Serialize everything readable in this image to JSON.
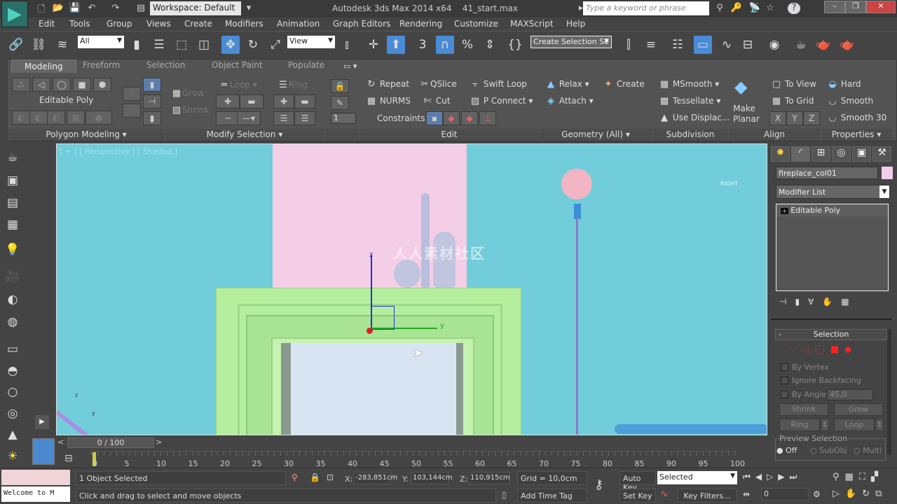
{
  "app": {
    "logo": "3ds Max logo",
    "title": "Autodesk 3ds Max  2014 x64",
    "file": "41_start.max",
    "workspace": "Workspace: Default",
    "search_placeholder": "Type a keyword or phrase"
  },
  "menu": [
    "Edit",
    "Tools",
    "Group",
    "Views",
    "Create",
    "Modifiers",
    "Animation",
    "Graph Editors",
    "Rendering",
    "Customize",
    "MAXScript",
    "Help"
  ],
  "toolbar": {
    "selection_filter": "All",
    "ref_coord": "View",
    "snap_label": "3",
    "named_selection": "Create Selection Se"
  },
  "ribbon": {
    "tabs": [
      "Modeling",
      "Freeform",
      "Selection",
      "Object Paint",
      "Populate"
    ],
    "active_tab": "Modeling",
    "polygon_modeling": {
      "object_type": "Editable Poly",
      "footer": "Polygon Modeling"
    },
    "modify_selection": {
      "grow": "Grow",
      "shrink": "Shrink",
      "loop": "Loop",
      "ring": "Ring",
      "footer": "Modify Selection"
    },
    "spinner_value": "1",
    "edit": {
      "repeat": "Repeat",
      "qslice": "QSlice",
      "swift_loop": "Swift Loop",
      "nurms": "NURMS",
      "cut": "Cut",
      "p_connect": "P Connect",
      "constraints": "Constraints:",
      "footer": "Edit"
    },
    "geometry": {
      "relax": "Relax",
      "create": "Create",
      "attach": "Attach",
      "footer": "Geometry (All)"
    },
    "subdivision": {
      "msmooth": "MSmooth",
      "tessellate": "Tessellate",
      "use_displace": "Use Displac...",
      "footer": "Subdivision"
    },
    "align": {
      "make_planar": "Make Planar",
      "to_view": "To View",
      "to_grid": "To Grid",
      "x": "X",
      "y": "Y",
      "z": "Z",
      "footer": "Align"
    },
    "properties": {
      "hard": "Hard",
      "smooth": "Smooth",
      "smooth30": "Smooth 30",
      "footer": "Properties"
    }
  },
  "viewport": {
    "label": "[ + ] [ Perspective ] [ Shaded ]",
    "viewcube": "RIGHT",
    "gizmo_z": "z",
    "gizmo_y": "y",
    "corner_z": "z",
    "corner_y": "y",
    "watermark": "人人素材社区",
    "colors": {
      "background": "#72cddb",
      "wall": "#f4cde6",
      "fireplace": "#b6eea0",
      "opening": "#d9e4f3"
    }
  },
  "command_panel": {
    "object_name": "fireplace_col01",
    "object_color": "#f3cde9",
    "modifier_list": "Modifier List",
    "stack": [
      "Editable Poly"
    ],
    "selection": {
      "title": "Selection",
      "by_vertex": "By Vertex",
      "ignore_backfacing": "Ignore Backfacing",
      "by_angle": "By Angle:",
      "angle": "45,0",
      "shrink": "Shrink",
      "grow": "Grow",
      "ring": "Ring",
      "loop": "Loop",
      "preview": "Preview Selection",
      "off": "Off",
      "subobj": "SubObj",
      "multi": "Multi"
    }
  },
  "timeline": {
    "frame": "0 / 100",
    "ticks": [
      "0",
      "5",
      "10",
      "15",
      "20",
      "25",
      "30",
      "35",
      "40",
      "45",
      "50",
      "55",
      "60",
      "65",
      "70",
      "75",
      "80",
      "85",
      "90",
      "95",
      "100"
    ]
  },
  "status": {
    "maxscript": "Welcome to M",
    "selected": "1 Object Selected",
    "prompt": "Click and drag to select and move objects",
    "x_label": "X:",
    "x": "-283,851cm",
    "y_label": "Y:",
    "y": "103,144cm",
    "z_label": "Z:",
    "z": "110,915cm",
    "grid": "Grid = 10,0cm",
    "add_time_tag": "Add Time Tag",
    "auto_key": "Auto Key",
    "set_key": "Set Key",
    "key_mode": "Selected",
    "key_filters": "Key Filters...",
    "current_frame": "0"
  }
}
